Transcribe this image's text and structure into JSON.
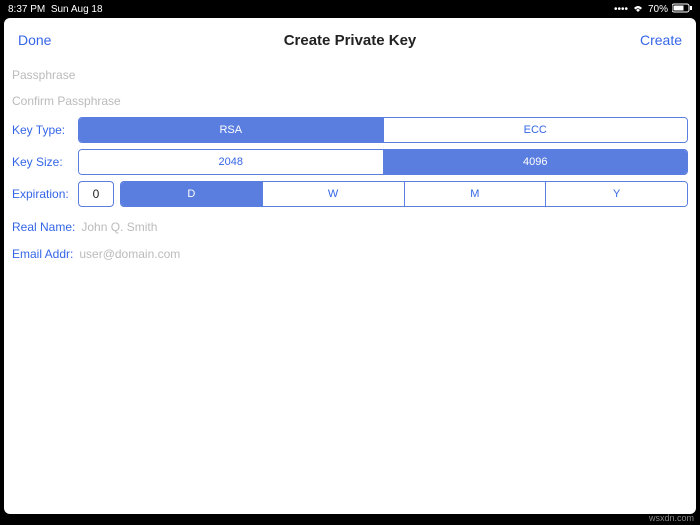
{
  "statusbar": {
    "time": "8:37 PM",
    "date": "Sun Aug 18",
    "battery": "70%"
  },
  "nav": {
    "done": "Done",
    "title": "Create Private Key",
    "create": "Create"
  },
  "fields": {
    "passphrase_ph": "Passphrase",
    "confirm_ph": "Confirm Passphrase",
    "keytype_label": "Key Type:",
    "keysize_label": "Key Size:",
    "expiration_label": "Expiration:",
    "expiration_value": "0",
    "realname_label": "Real Name:",
    "realname_ph": "John Q. Smith",
    "email_label": "Email Addr:",
    "email_ph": "user@domain.com"
  },
  "keytype": {
    "options": [
      "RSA",
      "ECC"
    ],
    "selected": 0
  },
  "keysize": {
    "options": [
      "2048",
      "4096"
    ],
    "selected": 1
  },
  "units": {
    "options": [
      "D",
      "W",
      "M",
      "Y"
    ],
    "selected": 0
  },
  "watermark": "wsxdn.com"
}
